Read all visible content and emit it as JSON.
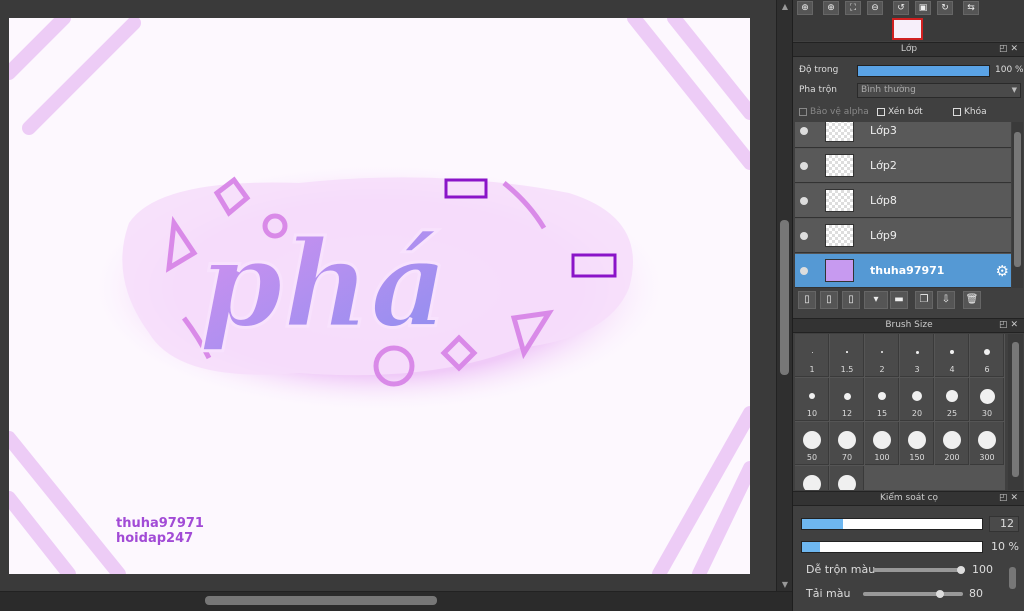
{
  "canvas": {
    "artwork_text": "phá",
    "watermark_line1": "thuha97971",
    "watermark_line2": "hoidap247"
  },
  "navigator": {
    "buttons": [
      "zoom-fit-icon",
      "zoom-in-icon",
      "fit-window-icon",
      "zoom-out-icon",
      "rotate-left-icon",
      "actual-size-icon",
      "rotate-right-icon",
      "flip-icon"
    ]
  },
  "layers_panel": {
    "title": "Lớp",
    "opacity_label": "Độ trong",
    "opacity_value": "100 %",
    "opacity_fraction": 1.0,
    "blend_label": "Pha trộn",
    "blend_value": "Bình thường",
    "protect_alpha_label": "Bảo vệ alpha",
    "clipping_label": "Xén bớt",
    "lock_label": "Khóa",
    "layers": [
      {
        "name": "Lớp3",
        "selected": false
      },
      {
        "name": "Lớp2",
        "selected": false
      },
      {
        "name": "Lớp8",
        "selected": false
      },
      {
        "name": "Lớp9",
        "selected": false
      },
      {
        "name": "thuha97971",
        "selected": true
      }
    ]
  },
  "brush_size_panel": {
    "title": "Brush Size",
    "sizes": [
      "1",
      "1.5",
      "2",
      "3",
      "4",
      "6",
      "10",
      "12",
      "15",
      "20",
      "25",
      "30",
      "50",
      "70",
      "100",
      "150",
      "200",
      "300",
      "",
      ""
    ]
  },
  "brush_control_panel": {
    "title": "Kiểm soát cọ",
    "size_value": "12",
    "size_fraction": 0.23,
    "opacity_value": "10 %",
    "opacity_fraction": 0.1,
    "blend_label": "Dễ trộn màu",
    "blend_value": "100",
    "blend_fraction": 1.0,
    "load_label": "Tải màu",
    "load_value": "80",
    "load_fraction": 0.8
  },
  "colors": {
    "panel_bg": "#404040",
    "selected_layer": "#5599d4",
    "accent_blue": "#5aa3e6",
    "artwork_purple": "#a24bd6"
  }
}
